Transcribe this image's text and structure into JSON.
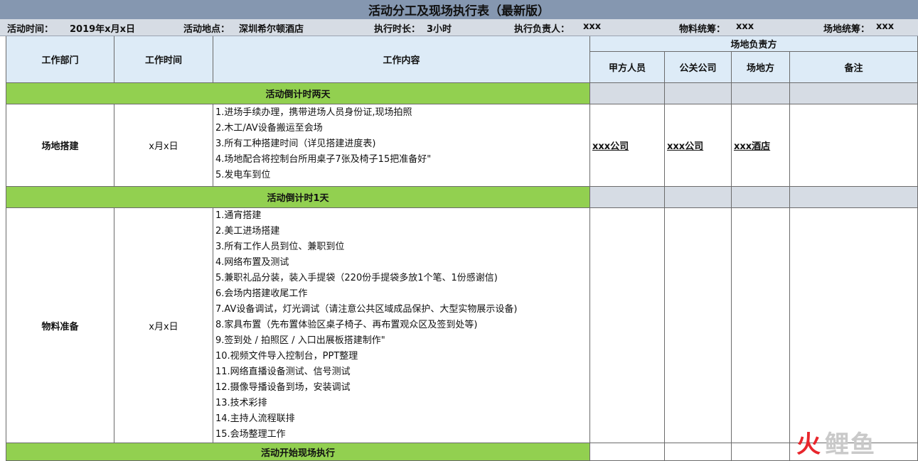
{
  "title": "活动分工及现场执行表（最新版）",
  "info": {
    "time_label": "活动时间：",
    "time_value": "2019年x月x日",
    "place_label": "活动地点：",
    "place_value": "深圳希尔顿酒店",
    "duration_label": "执行时长：",
    "duration_value": "3小时",
    "owner_label": "执行负责人：",
    "owner_value": "xxx",
    "material_label": "物料统筹：",
    "material_value": "xxx",
    "venue_label": "场地统筹：",
    "venue_value": "xxx"
  },
  "headers": {
    "dept": "工作部门",
    "time": "工作时间",
    "content": "工作内容",
    "venue_owner": "场地负责方",
    "party_a": "甲方人员",
    "pr_company": "公关公司",
    "venue": "场地方",
    "notes": "备注"
  },
  "sections": [
    "活动倒计时两天",
    "活动倒计时1天",
    "活动开始现场执行"
  ],
  "rows": [
    {
      "dept": "场地搭建",
      "time": "x月x日",
      "items": [
        "1.进场手续办理，携带进场人员身份证,现场拍照",
        "2.木工/AV设备搬运至会场",
        "3.所有工种搭建时间（详见搭建进度表)",
        "4.场地配合将控制台所用桌子7张及椅子15把准备好\"",
        "5.发电车到位"
      ],
      "party_a": "xxx公司",
      "pr_company": "xxx公司",
      "venue": "xxx酒店"
    },
    {
      "dept": "物料准备",
      "time": "x月x日",
      "items": [
        "1.通宵搭建",
        "2.美工进场搭建",
        "3.所有工作人员到位、兼职到位",
        "4.网络布置及测试",
        "5.兼职礼品分装，装入手提袋（220份手提袋多放1个笔、1份感谢信)",
        "6.会场内搭建收尾工作",
        "7.AV设备调试，灯光调试（请注意公共区域成品保护、大型实物展示设备)",
        "8.家具布置（先布置体验区桌子椅子、再布置观众区及签到处等)",
        "9.签到处 / 拍照区 / 入口出展板搭建制作\"",
        "10.视频文件导入控制台，PPT整理",
        "11.网络直播设备测试、信号测试",
        "12.摄像导播设备到场，安装调试",
        "13.技术彩排",
        "14.主持人流程联排",
        "15.会场整理工作"
      ]
    }
  ],
  "watermark": {
    "part1": "火",
    "part2": "鲤鱼"
  }
}
